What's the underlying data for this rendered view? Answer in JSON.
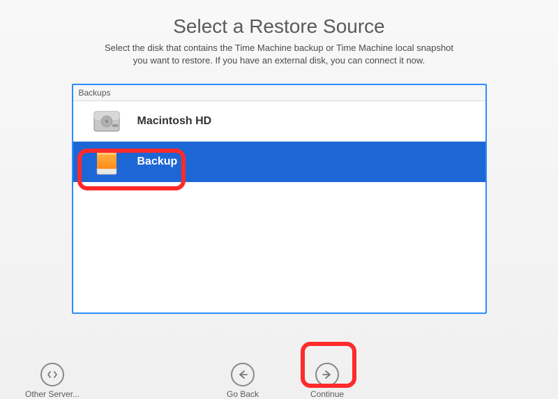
{
  "header": {
    "title": "Select a Restore Source",
    "subtitle_line1": "Select the disk that contains the Time Machine backup or Time Machine local snapshot",
    "subtitle_line2": "you want to restore. If you have an external disk, you can connect it now."
  },
  "panel": {
    "header_label": "Backups",
    "items": [
      {
        "label": "Macintosh HD",
        "icon": "internal-disk",
        "selected": false
      },
      {
        "label": "Backup",
        "icon": "external-disk",
        "selected": true
      }
    ]
  },
  "footer": {
    "other_server_label": "Other Server...",
    "go_back_label": "Go Back",
    "continue_label": "Continue"
  },
  "highlights": [
    {
      "target": "backup-item"
    },
    {
      "target": "continue-button"
    }
  ],
  "colors": {
    "selection": "#1d66d6",
    "panel_border": "#2a8cff",
    "highlight": "#ff2a2a"
  }
}
